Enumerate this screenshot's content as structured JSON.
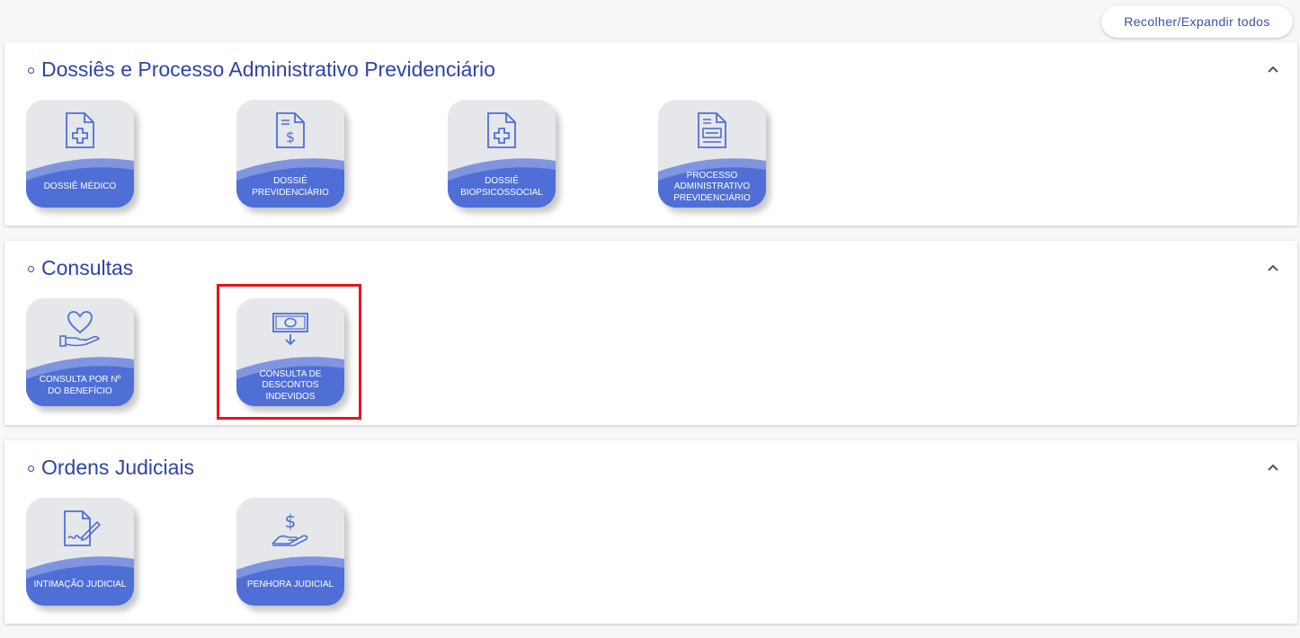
{
  "toolbar": {
    "toggle_all_label": "Recolher/Expandir todos"
  },
  "colors": {
    "accent": "#2e44a6",
    "tile_bg": "#e6e7eb",
    "wave": "#4f6fd6",
    "highlight": "#e3151e"
  },
  "sections": [
    {
      "title": "Dossiês e Processo Administrativo Previdenciário",
      "expanded": true,
      "tiles": [
        {
          "icon": "medical-document-icon",
          "label": "Dossiê Médico"
        },
        {
          "icon": "money-document-icon",
          "label": "Dossiê Previdenciário"
        },
        {
          "icon": "medical-document-icon",
          "label": "Dossiê Biopsicossocial"
        },
        {
          "icon": "administrative-process-icon",
          "label": "Processo Administrativo Previdenciário"
        }
      ]
    },
    {
      "title": "Consultas",
      "expanded": true,
      "tiles": [
        {
          "icon": "heart-hand-icon",
          "label": "Consulta por Nº do Benefício"
        },
        {
          "icon": "banknote-down-icon",
          "label": "Consulta de Descontos Indevidos",
          "highlighted": true
        }
      ]
    },
    {
      "title": "Ordens Judiciais",
      "expanded": true,
      "tiles": [
        {
          "icon": "signed-document-icon",
          "label": "Intimação Judicial"
        },
        {
          "icon": "money-hand-icon",
          "label": "Penhora Judicial"
        }
      ]
    }
  ]
}
